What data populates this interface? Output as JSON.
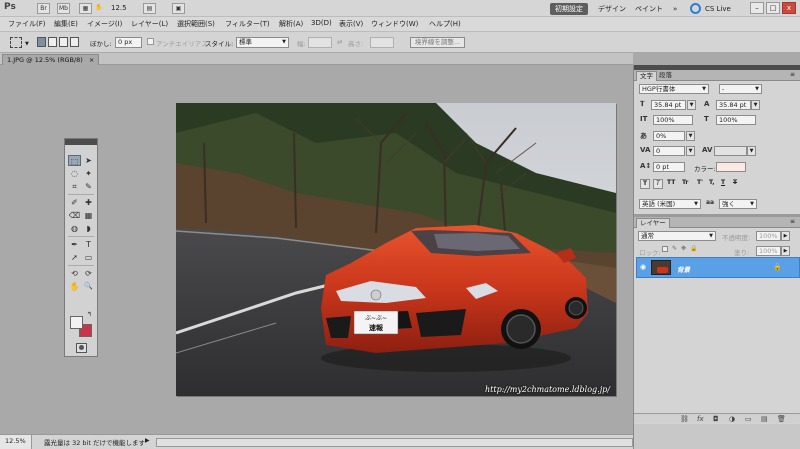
{
  "app": {
    "logo": "Ps",
    "zoom_value": "12.5",
    "workspaces": [
      "初期設定",
      "デザイン",
      "ペイント"
    ],
    "workspace_more": "»",
    "cs_live": "CS Live",
    "window_buttons": [
      "–",
      "□",
      "x"
    ]
  },
  "menu": [
    "ファイル(F)",
    "編集(E)",
    "イメージ(I)",
    "レイヤー(L)",
    "選択範囲(S)",
    "フィルター(T)",
    "解析(A)",
    "3D(D)",
    "表示(V)",
    "ウィンドウ(W)",
    "ヘルプ(H)"
  ],
  "options": {
    "feather_label": "ぼかし:",
    "feather_value": "0 px",
    "antialias_label": "アンチエイリアス",
    "style_label": "スタイル:",
    "style_value": "標準",
    "width_label": "幅:",
    "height_label": "高さ:",
    "refine_button": "境界線を調整..."
  },
  "document": {
    "tab_label": "1.JPG @ 12.5% (RGB/8)",
    "tab_close": "×",
    "watermark": "http://my2chmatome.ldblog.jp/",
    "plate_line1": "ぶ~ぶ~",
    "plate_line2": "速報"
  },
  "toolbox": {
    "tools": [
      "⬚",
      "➤",
      "◌",
      "✦",
      "⌗",
      "✎",
      "✐",
      "✚",
      "⌫",
      "▦",
      "◍",
      "◗",
      "✒",
      "T",
      "➚",
      "▭",
      "✋",
      "🔍"
    ]
  },
  "status": {
    "zoom": "12.5%",
    "message": "露光量は 32 bit だけで機能します"
  },
  "character_panel": {
    "tabs": [
      "文字",
      "段落"
    ],
    "font": "HGP行書体",
    "font_style": "-",
    "size": "35.84 pt",
    "leading": "35.84 pt",
    "vscale": "100%",
    "hscale": "100%",
    "tracking_pct": "0%",
    "tracking": "0",
    "baseline": "0 pt",
    "color_label": "カラー:",
    "style_buttons": [
      "T",
      "T",
      "TT",
      "Tr",
      "T'",
      "T,",
      "T",
      "T"
    ],
    "language": "英語 (米国)",
    "antialias_icon": "aa",
    "antialias": "強く"
  },
  "layers_panel": {
    "tab": "レイヤー",
    "blend_mode": "通常",
    "opacity_label": "不透明度:",
    "opacity": "100%",
    "lock_label": "ロック:",
    "fill_label": "塗り:",
    "fill": "100%",
    "layer_name": "背景",
    "footer_icons": [
      "⛓",
      "fx",
      "◘",
      "◑",
      "▭",
      "▤",
      "🗑"
    ]
  },
  "colors": {
    "selected_layer": "#5aa0e6",
    "workspace_active": "#5e5e5e",
    "foreground": "#f2f2f2",
    "background": "#c8354a"
  }
}
